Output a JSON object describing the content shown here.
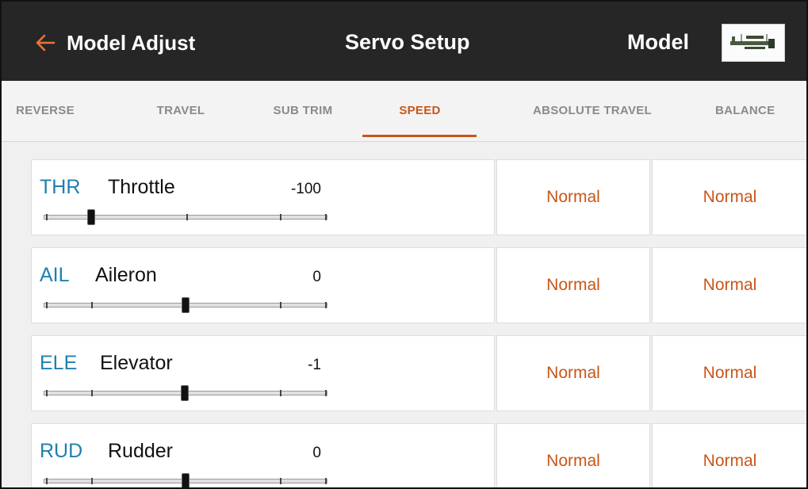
{
  "header": {
    "back_label": "Model Adjust",
    "title": "Servo Setup",
    "model_label": "Model",
    "back_icon": "arrow-left-icon",
    "model_image": "airplane-thumbnail"
  },
  "tabs": [
    {
      "label": "REVERSE",
      "active": false
    },
    {
      "label": "TRAVEL",
      "active": false
    },
    {
      "label": "SUB TRIM",
      "active": false
    },
    {
      "label": "SPEED",
      "active": true
    },
    {
      "label": "ABSOLUTE TRAVEL",
      "active": false
    },
    {
      "label": "BALANCE",
      "active": false
    }
  ],
  "channels": [
    {
      "abbr": "THR",
      "name": "Throttle",
      "value": "-100",
      "slider_value": -100,
      "col1": "Normal",
      "col2": "Normal"
    },
    {
      "abbr": "AIL",
      "name": "Aileron",
      "value": "0",
      "slider_value": 0,
      "col1": "Normal",
      "col2": "Normal"
    },
    {
      "abbr": "ELE",
      "name": "Elevator",
      "value": "-1",
      "slider_value": -1,
      "col1": "Normal",
      "col2": "Normal"
    },
    {
      "abbr": "RUD",
      "name": "Rudder",
      "value": "0",
      "slider_value": 0,
      "col1": "Normal",
      "col2": "Normal"
    }
  ],
  "colors": {
    "accent": "#c85618",
    "channel_abbr": "#1f7fb0",
    "header_bg": "#262626"
  }
}
